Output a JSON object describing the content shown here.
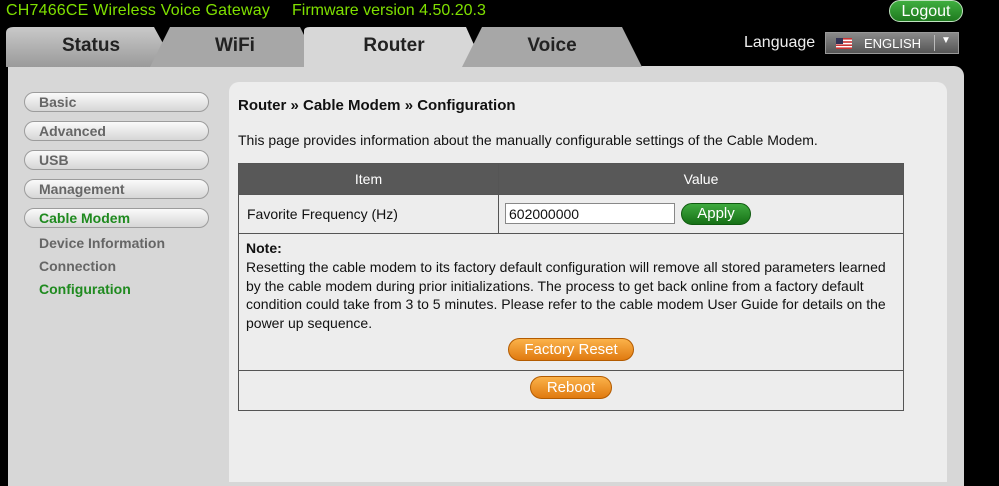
{
  "header": {
    "model": "CH7466CE  Wireless Voice Gateway",
    "firmware": "Firmware version  4.50.20.3",
    "logout_label": "Logout"
  },
  "tabs": [
    {
      "label": "Status"
    },
    {
      "label": "WiFi"
    },
    {
      "label": "Router",
      "active": true
    },
    {
      "label": "Voice"
    }
  ],
  "language": {
    "label": "Language",
    "selected": "ENGLISH"
  },
  "sidebar": {
    "items": [
      {
        "label": "Basic"
      },
      {
        "label": "Advanced"
      },
      {
        "label": "USB"
      },
      {
        "label": "Management"
      },
      {
        "label": "Cable Modem",
        "active": true
      }
    ],
    "subitems": [
      {
        "label": "Device Information"
      },
      {
        "label": "Connection"
      },
      {
        "label": "Configuration",
        "active": true
      }
    ]
  },
  "main": {
    "title": "Router » Cable Modem » Configuration",
    "description": "This page provides information about the manually configurable settings of the Cable Modem.",
    "table": {
      "col_item": "Item",
      "col_value": "Value",
      "freq_label": "Favorite Frequency (Hz)",
      "freq_value": "602000000",
      "apply_label": "Apply"
    },
    "note_title": "Note:",
    "note_text": "Resetting the cable modem to its factory default configuration will remove all stored parameters learned by the cable modem during prior initializations. The process to get back online from a factory default condition could take from 3 to 5 minutes. Please refer to the cable modem User Guide for details on the power up sequence.",
    "factory_reset_label": "Factory Reset",
    "reboot_label": "Reboot"
  },
  "colors": {
    "header_green": "#7fe000",
    "active_green": "#1f8a1f",
    "orange_button": "#f0901f",
    "table_header": "#585858"
  }
}
